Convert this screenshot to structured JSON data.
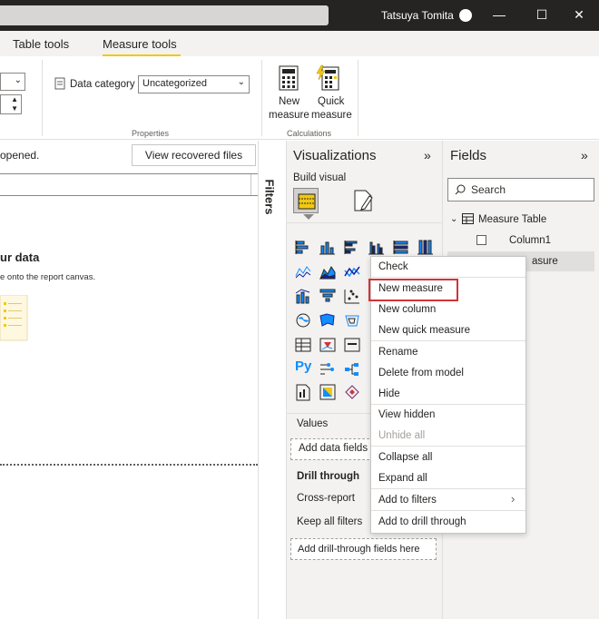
{
  "titlebar": {
    "user_name": "Tatsuya Tomita",
    "minimize": "—",
    "maximize": "☐",
    "close": "✕"
  },
  "tabs": [
    {
      "label": "Table tools"
    },
    {
      "label": "Measure tools"
    }
  ],
  "ribbon": {
    "data_category_label": "Data category",
    "data_category_value": "Uncategorized",
    "properties_group": "Properties",
    "calculations_group": "Calculations",
    "new_measure_line1": "New",
    "new_measure_line2": "measure",
    "quick_measure_line1": "Quick",
    "quick_measure_line2": "measure"
  },
  "canvas": {
    "recovery_message": "opened.",
    "recovered_button": "View recovered files",
    "close": "✕",
    "heading_fragment": "ur data",
    "subtext_fragment": "e onto the report canvas.",
    "filters_label": "Filters"
  },
  "visualizations": {
    "title": "Visualizations",
    "build_visual": "Build visual",
    "values_label": "Values",
    "add_data_fields": "Add data fields",
    "drill_through": "Drill through",
    "cross_report": "Cross-report",
    "keep_all_filters": "Keep all filters",
    "add_drill_through": "Add drill-through fields here",
    "py_label": "Py"
  },
  "fields": {
    "title": "Fields",
    "search_placeholder": "Search",
    "table_name": "Measure Table",
    "column1": "Column1",
    "measure_fragment": "asure"
  },
  "context_menu": {
    "items": [
      {
        "label": "Check"
      },
      {
        "label": "New measure"
      },
      {
        "label": "New column"
      },
      {
        "label": "New quick measure"
      },
      {
        "label": "Rename"
      },
      {
        "label": "Delete from model"
      },
      {
        "label": "Hide"
      },
      {
        "label": "View hidden"
      },
      {
        "label": "Unhide all"
      },
      {
        "label": "Collapse all"
      },
      {
        "label": "Expand all"
      },
      {
        "label": "Add to filters"
      },
      {
        "label": "Add to drill through"
      }
    ]
  },
  "colors": {
    "accent": "#f2c811",
    "highlight_box": "#d13438",
    "dark": "#252423"
  }
}
